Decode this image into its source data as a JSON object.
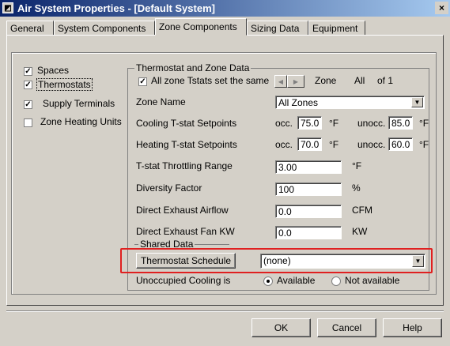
{
  "window": {
    "title": "Air System Properties - [Default System]",
    "close_glyph": "×",
    "icon": "app-icon"
  },
  "tabs": [
    {
      "label": "General"
    },
    {
      "label": "System Components"
    },
    {
      "label": "Zone Components",
      "active": true
    },
    {
      "label": "Sizing Data"
    },
    {
      "label": "Equipment"
    }
  ],
  "left_options": [
    {
      "label": "Spaces",
      "checked": true
    },
    {
      "label": "Thermostats",
      "checked": true,
      "focused": true
    },
    {
      "label": "Supply Terminals",
      "checked": true
    },
    {
      "label": "Zone Heating Units",
      "checked": false
    }
  ],
  "thermostat_group": {
    "legend": "Thermostat and Zone Data",
    "all_same_label": "All zone Tstats set the same",
    "all_same_checked": true,
    "zone_label": "Zone",
    "zone_value": "All",
    "of_label": "of 1",
    "zone_name_label": "Zone Name",
    "zone_name_value": "All Zones",
    "cooling_label": "Cooling T-stat Setpoints",
    "heating_label": "Heating T-stat Setpoints",
    "occ_label": "occ.",
    "unocc_label": "unocc.",
    "deg_f": "°F",
    "cooling_occ": "75.0",
    "cooling_unocc": "85.0",
    "heating_occ": "70.0",
    "heating_unocc": "60.0",
    "throttling_label": "T-stat Throttling Range",
    "throttling_value": "3.00",
    "throttling_unit": "°F",
    "diversity_label": "Diversity Factor",
    "diversity_value": "100",
    "diversity_unit": "%",
    "exhaust_airflow_label": "Direct Exhaust Airflow",
    "exhaust_airflow_value": "0.0",
    "exhaust_airflow_unit": "CFM",
    "exhaust_fan_label": "Direct Exhaust Fan KW",
    "exhaust_fan_value": "0.0",
    "exhaust_fan_unit": "KW"
  },
  "shared_data": {
    "legend": "Shared Data",
    "schedule_button": "Thermostat Schedule",
    "schedule_value": "(none)",
    "unoccupied_label": "Unoccupied Cooling is",
    "available_label": "Available",
    "not_available_label": "Not available",
    "selected": "Available"
  },
  "buttons": {
    "ok": "OK",
    "cancel": "Cancel",
    "help": "Help"
  },
  "colors": {
    "highlight": "#e02020",
    "titlebar_start": "#0a246a",
    "titlebar_end": "#a6caf0"
  }
}
